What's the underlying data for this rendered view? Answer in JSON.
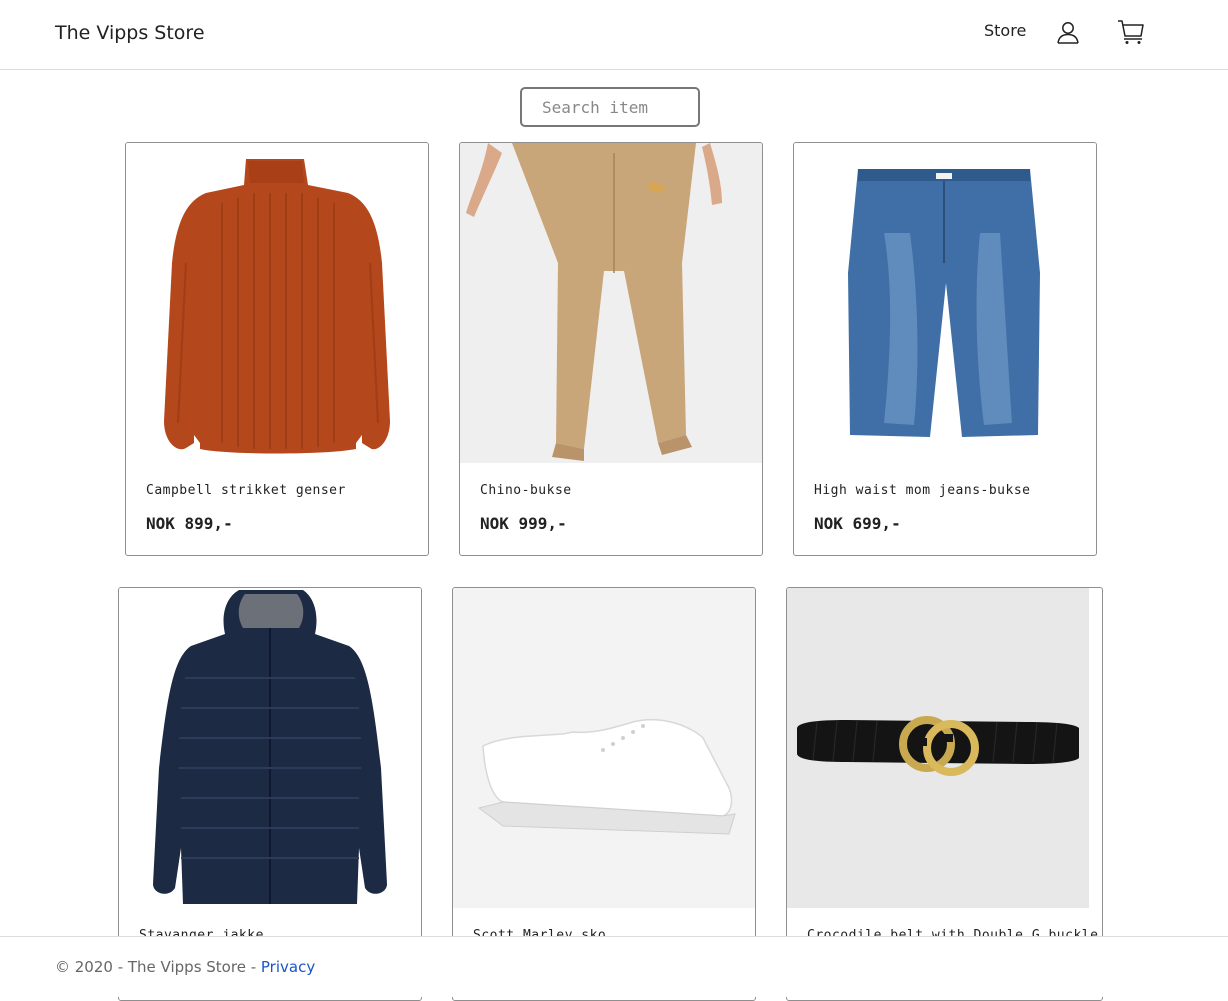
{
  "header": {
    "brand": "The Vipps Store",
    "nav_store": "Store",
    "user_icon": "user-icon",
    "cart_icon": "shopping-cart-icon"
  },
  "search": {
    "placeholder": "Search item"
  },
  "products": [
    {
      "name": "Campbell strikket genser",
      "price": "NOK 899,-",
      "image": "orange knit sweater"
    },
    {
      "name": "Chino-bukse",
      "price": "NOK 999,-",
      "image": "beige chino trousers"
    },
    {
      "name": "High waist mom jeans-bukse",
      "price": "NOK 699,-",
      "image": "blue jeans"
    },
    {
      "name": "Stavanger jakke",
      "price": "",
      "image": "navy puffer jacket"
    },
    {
      "name": "Scott Marley sko",
      "price": "",
      "image": "white sneaker"
    },
    {
      "name": "Crocodile belt with Double G buckle",
      "price": "",
      "image": "black belt with gold buckle"
    }
  ],
  "footer": {
    "copyright": "© 2020 - The Vipps Store - ",
    "privacy": "Privacy"
  },
  "colors": {
    "link": "#1a55c7",
    "border": "#8f8f8f"
  }
}
